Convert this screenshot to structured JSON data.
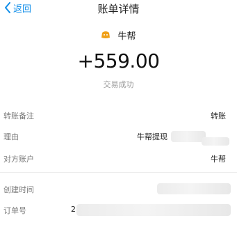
{
  "nav": {
    "back_label": "返回",
    "title": "账单详情"
  },
  "merchant": {
    "name": "牛帮",
    "icon": "merchant-logo-icon"
  },
  "amount": "+559.00",
  "status": "交易成功",
  "details": {
    "transfer_note": {
      "label": "转账备注",
      "value": "转账"
    },
    "reason": {
      "label": "理由",
      "value": "牛帮提现"
    },
    "counterparty": {
      "label": "对方账户",
      "value": "牛帮"
    },
    "created_time": {
      "label": "创建时间"
    },
    "order_no": {
      "label": "订单号",
      "value_prefix": "2"
    }
  },
  "colors": {
    "accent": "#108ee9",
    "label_gray": "#7a7a7a",
    "logo_orange": "#f0a018"
  }
}
